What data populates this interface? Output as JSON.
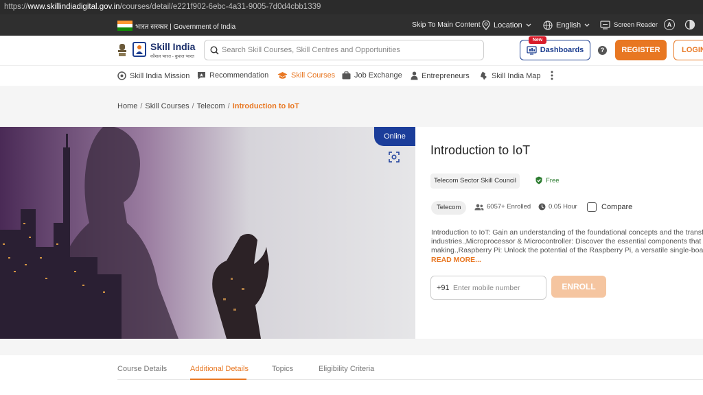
{
  "browser": {
    "url_prefix": "https://",
    "url_domain": "www.skillindiadigital.gov.in",
    "url_path": "/courses/detail/e221f902-6ebc-4a31-9005-7d0d4cbb1339"
  },
  "govbar": {
    "hindi": "भारत सरकार",
    "separator": " | ",
    "english": "Government of India",
    "skip": "Skip To Main Content",
    "location": "Location",
    "language": "English",
    "screen_reader": "Screen Reader",
    "font_icon_label": "A"
  },
  "header": {
    "logo_main": "Skill India",
    "logo_sub": "कौशल भारत - कुशल भारत",
    "search_placeholder": "Search Skill Courses, Skill Centres and Opportunities",
    "new_badge": "New",
    "dashboards": "Dashboards",
    "help": "?",
    "register": "REGISTER",
    "login": "LOGIN"
  },
  "nav": {
    "items": [
      {
        "label": "Skill India Mission"
      },
      {
        "label": "Recommendation"
      },
      {
        "label": "Skill Courses"
      },
      {
        "label": "Job Exchange"
      },
      {
        "label": "Entrepreneurs"
      },
      {
        "label": "Skill India Map"
      }
    ]
  },
  "breadcrumb": {
    "items": [
      "Home",
      "Skill Courses",
      "Telecom"
    ],
    "current": "Introduction to IoT",
    "sep": "/"
  },
  "course": {
    "mode": "Online",
    "title": "Introduction to IoT",
    "sector": "Telecom Sector Skill Council",
    "price": "Free",
    "category": "Telecom",
    "enrolled": "6057+ Enrolled",
    "duration": "0.05 Hour",
    "compare": "Compare",
    "description_lines": [
      "Introduction to IoT: Gain an understanding of the foundational concepts and the transformative",
      "industries.,Microprocessor & Microcontroller: Discover the essential components that",
      "making.,Raspberry Pi: Unlock the potential of the Raspberry Pi, a versatile single-board"
    ],
    "read_more": "READ MORE...",
    "country_code": "+91",
    "phone_placeholder": "Enter mobile number",
    "enroll": "ENROLL"
  },
  "tabs": [
    {
      "label": "Course Details"
    },
    {
      "label": "Additional Details"
    },
    {
      "label": "Topics"
    },
    {
      "label": "Eligibility Criteria"
    }
  ],
  "colors": {
    "accent": "#e87722",
    "brand_blue": "#1b3d8f",
    "free_green": "#2e7d32"
  }
}
